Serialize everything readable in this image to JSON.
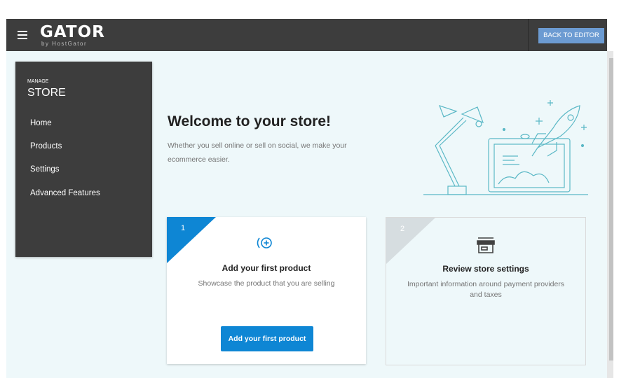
{
  "header": {
    "logo_text": "GATOR",
    "logo_subtext": "by HostGator",
    "back_button_label": "BACK TO EDITOR"
  },
  "sidebar": {
    "section_label": "MANAGE",
    "title": "STORE",
    "items": [
      {
        "label": "Home"
      },
      {
        "label": "Products"
      },
      {
        "label": "Settings"
      },
      {
        "label": "Advanced Features"
      }
    ]
  },
  "main": {
    "title": "Welcome to your store!",
    "subtitle": "Whether you sell online or sell on social, we make your ecommerce easier."
  },
  "cards": [
    {
      "step": "1",
      "icon": "add-circle-icon",
      "title": "Add your first product",
      "description": "Showcase the product that you are selling",
      "button_label": "Add your first product",
      "accent_color": "#0e86d4"
    },
    {
      "step": "2",
      "icon": "storefront-icon",
      "title": "Review store settings",
      "description": "Important information around payment providers and taxes",
      "accent_color": "#d6dde0"
    }
  ],
  "colors": {
    "topbar": "#3d3d3d",
    "sidebar": "#3d3d3d",
    "content_bg": "#eef8fa",
    "back_button": "#6c9bd2",
    "illustration": "#5bb8c6"
  }
}
